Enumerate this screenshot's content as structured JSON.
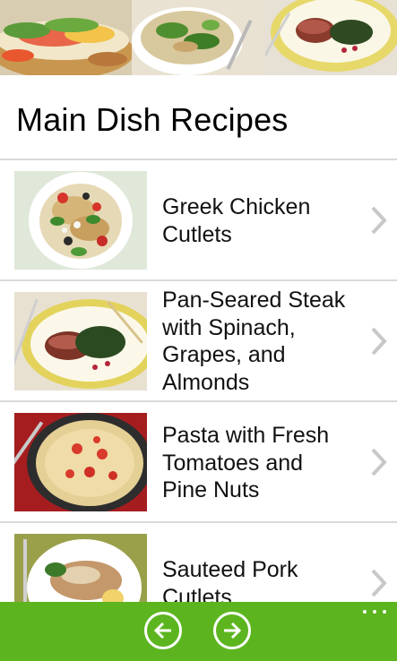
{
  "page": {
    "title": "Main Dish Recipes"
  },
  "recipes": [
    {
      "title": "Greek Chicken Cutlets"
    },
    {
      "title": "Pan-Seared Steak with Spinach, Grapes, and Almonds"
    },
    {
      "title": "Pasta with Fresh Tomatoes and Pine Nuts"
    },
    {
      "title": "Sauteed Pork Cutlets"
    }
  ],
  "appbar": {
    "color": "#5cb51f",
    "back_icon": "arrow-left-icon",
    "forward_icon": "arrow-right-icon",
    "more_icon": "ellipsis-icon"
  },
  "colors": {
    "separator": "#d9d9d9",
    "chevron": "#c8c8c8"
  }
}
